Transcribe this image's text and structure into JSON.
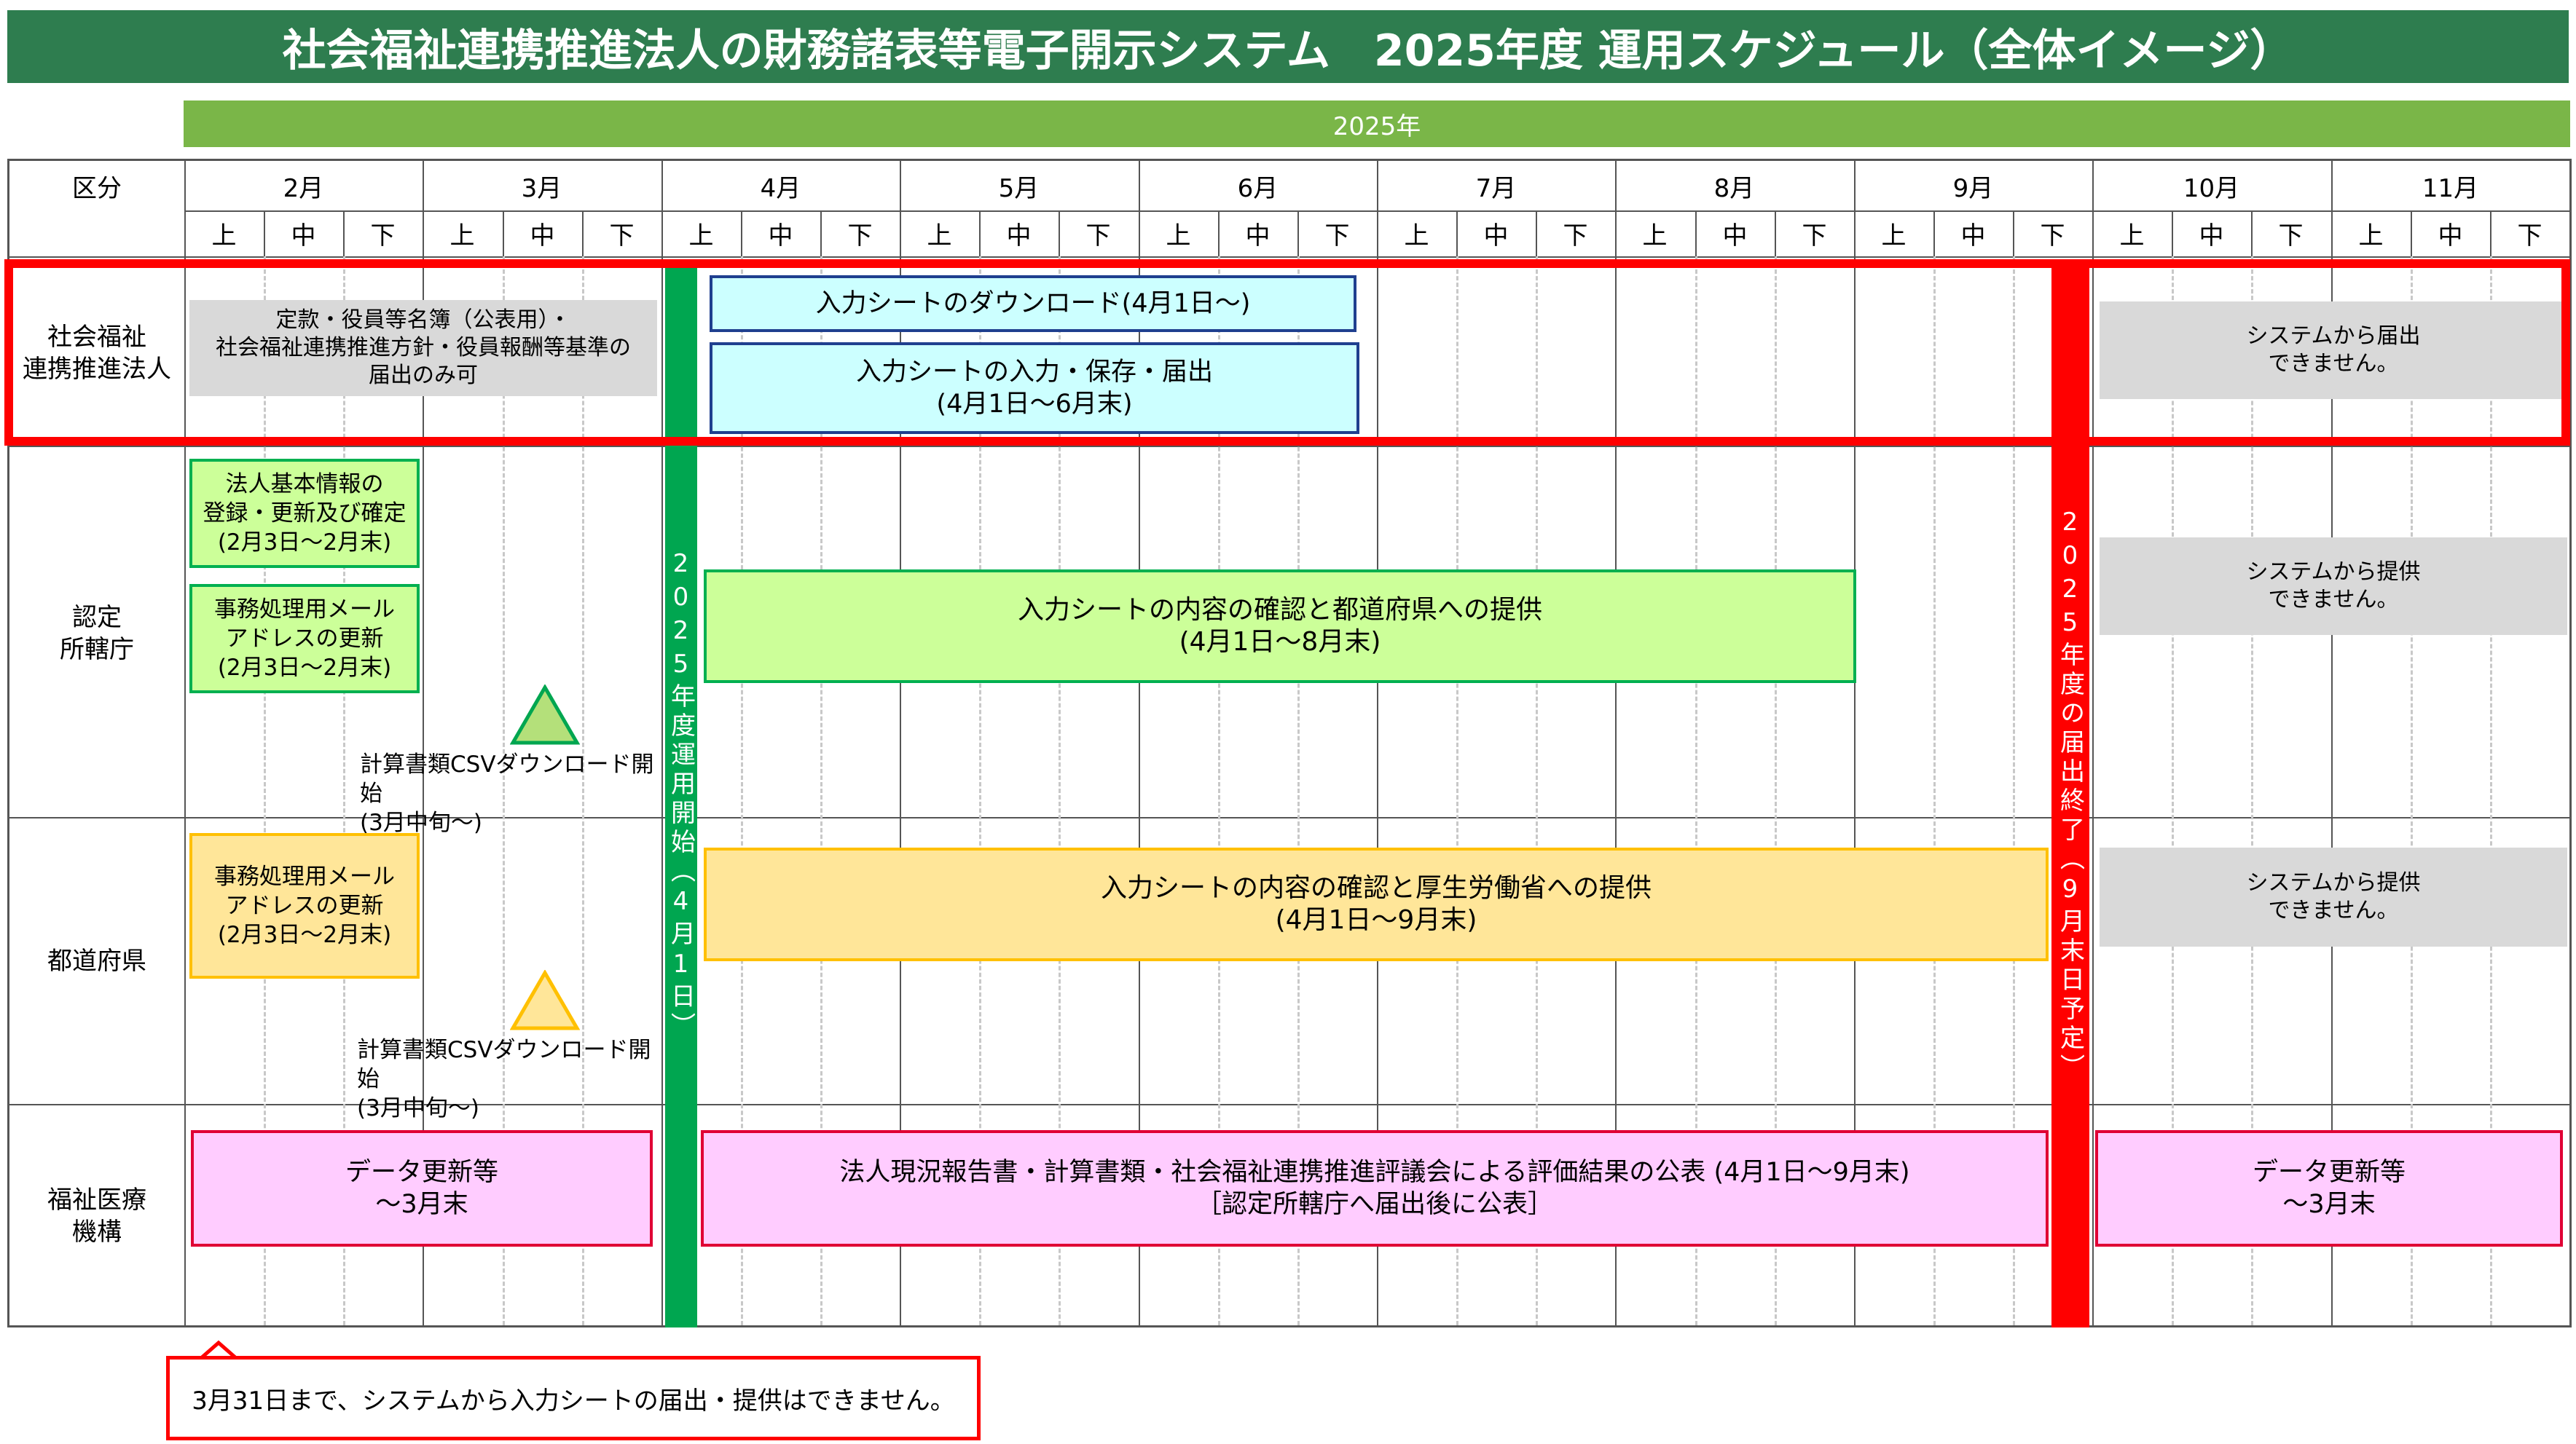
{
  "title": "社会福祉連携推進法人の財務諸表等電子開示システム　2025年度 運用スケジュール（全体イメージ）",
  "year_label": "2025年",
  "header": {
    "category_label": "区分",
    "months": [
      "2月",
      "3月",
      "4月",
      "5月",
      "6月",
      "7月",
      "8月",
      "9月",
      "10月",
      "11月"
    ],
    "periods": [
      "上",
      "中",
      "下"
    ]
  },
  "rows": {
    "corporation": "社会福祉\n連携推進法人",
    "authority": "認定\n所轄庁",
    "prefecture": "都道府県",
    "wam": "福祉医療\n機構"
  },
  "milestones": {
    "start": "2025年度運用開始（4月1日）",
    "end": "2025年度の届出終了（9月末日予定）"
  },
  "tasks": {
    "corp_pre": "定款・役員等名簿（公表用）・\n社会福祉連携推進方針・役員報酬等基準の\n届出のみ可",
    "corp_download": "入力シートのダウンロード(4月1日～)",
    "corp_input": "入力シートの入力・保存・届出\n(4月1日～6月末)",
    "corp_after": "システムから届出\nできません。",
    "auth_basic": "法人基本情報の\n登録・更新及び確定\n(2月3日～2月末)",
    "auth_mail": "事務処理用メール\nアドレスの更新\n(2月3日～2月末)",
    "auth_csv": "計算書類CSVダウンロード開始\n(3月中旬～)",
    "auth_main": "入力シートの内容の確認と都道府県への提供\n(4月1日～8月末)",
    "auth_after": "システムから提供\nできません。",
    "pref_mail": "事務処理用メール\nアドレスの更新\n(2月3日～2月末)",
    "pref_csv": "計算書類CSVダウンロード開始\n(3月中旬～)",
    "pref_main": "入力シートの内容の確認と厚生労働省への提供\n(4月1日～9月末)",
    "pref_after": "システムから提供\nできません。",
    "wam_pre": "データ更新等\n～3月末",
    "wam_main": "法人現況報告書・計算書類・社会福祉連携推進評議会による評価結果の公表 (4月1日～9月末)\n［認定所轄庁へ届出後に公表］",
    "wam_after": "データ更新等\n～3月末"
  },
  "note": "3月31日まで、システムから入力シートの届出・提供はできません。",
  "colors": {
    "title_bg": "#2E7D4F",
    "year_bg": "#7AB648",
    "start_bar": "#00A650",
    "end_bar": "#FF0000",
    "highlight": "#FF0000"
  }
}
